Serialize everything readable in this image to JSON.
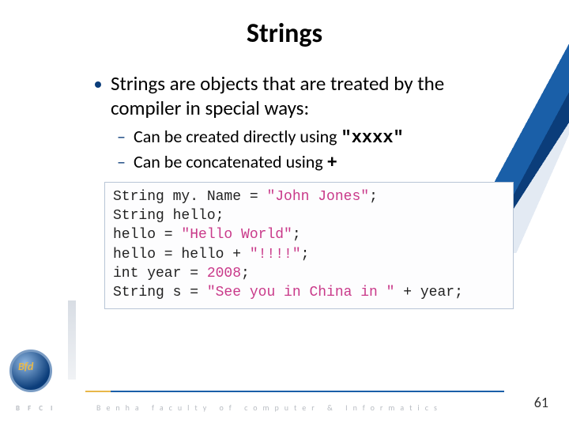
{
  "title": "Strings",
  "bullets": {
    "main": "Strings are objects that are treated by the compiler in special ways:",
    "sub1_text": "Can be created directly using ",
    "sub1_code": "\"xxxx\"",
    "sub2_text": "Can be concatenated using ",
    "sub2_code": "+"
  },
  "code": {
    "l1a": "String my. Name = ",
    "l1b": "\"John Jones\"",
    "l1c": ";",
    "l2": "String hello;",
    "l3a": "hello = ",
    "l3b": "\"Hello World\"",
    "l3c": ";",
    "l4a": "hello = hello + ",
    "l4b": "\"!!!!\"",
    "l4c": ";",
    "l5a": "int year = ",
    "l5b": "2008",
    "l5c": ";",
    "l6a": "String s = ",
    "l6b": "\"See you in China in \"",
    "l6c": " + year;"
  },
  "page_number": "61",
  "footer": "Benha faculty of computer & Informatics",
  "logo_text": "Bfd",
  "logo_label": "B F C I"
}
